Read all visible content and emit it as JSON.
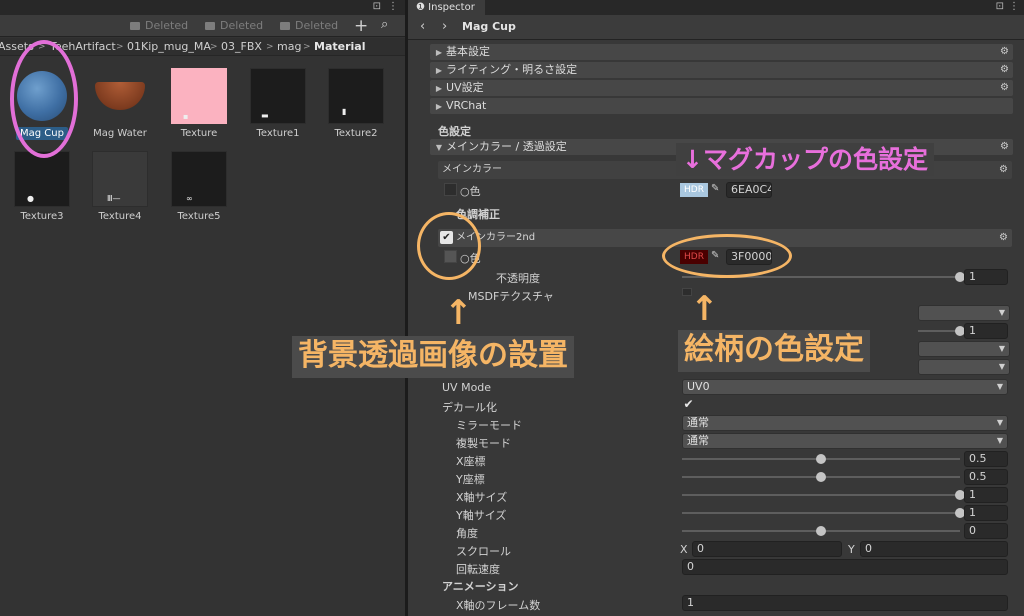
{
  "project": {
    "filters": [
      "Deleted",
      "Deleted",
      "Deleted"
    ],
    "plus_label": "+",
    "breadcrumb": [
      "Assets",
      "TeehArtifact",
      "01Kip_mug_MA",
      "03_FBX",
      "mag",
      "Material"
    ],
    "assets": [
      {
        "label": "Mag Cup",
        "selected": true,
        "thumb": "blue-sphere"
      },
      {
        "label": "Mag Water",
        "thumb": "brown-bowl"
      },
      {
        "label": "Texture",
        "thumb": "pink-square"
      },
      {
        "label": "Texture1",
        "thumb": "dark"
      },
      {
        "label": "Texture2",
        "thumb": "dark"
      },
      {
        "label": "Texture3",
        "thumb": "dark"
      },
      {
        "label": "Texture4",
        "thumb": "dark"
      },
      {
        "label": "Texture5",
        "thumb": "dark"
      }
    ],
    "thumb_marks": {
      "tex4": "Ⅲ—",
      "tex5": "∞"
    }
  },
  "inspector": {
    "tab_label": "Inspector",
    "title": "Mag Cup",
    "foldouts": [
      "基本設定",
      "ライティング・明るさ設定",
      "UV設定",
      "VRChat"
    ],
    "color_section": "色設定",
    "main_color_foldout": "メインカラー / 透過設定",
    "main_color_label": "メインカラー",
    "color_label": "色",
    "hdr_label": "HDR",
    "main_color_hex": "6EA0C4",
    "color_correction": "色調補正",
    "main_color_2nd": "メインカラー2nd",
    "color2_hex": "3F0000",
    "opacity_label": "不透明度",
    "opacity_value": "1",
    "msdf_label": "MSDFテクスチャ",
    "hidden_value": "1",
    "uv_mode_label": "UV Mode",
    "uv_mode_value": "UV0",
    "decal_label": "デカール化",
    "mirror_label": "ミラーモード",
    "mirror_value": "通常",
    "copy_label": "複製モード",
    "copy_value": "通常",
    "x_pos_label": "X座標",
    "x_pos_value": "0.5",
    "y_pos_label": "Y座標",
    "y_pos_value": "0.5",
    "x_size_label": "X軸サイズ",
    "x_size_value": "1",
    "y_size_label": "Y軸サイズ",
    "y_size_value": "1",
    "angle_label": "角度",
    "angle_value": "0",
    "scroll_label": "スクロール",
    "scroll_x_label": "X",
    "scroll_x_value": "0",
    "scroll_y_label": "Y",
    "scroll_y_value": "0",
    "rotation_label": "回転速度",
    "rotation_value": "0",
    "animation_label": "アニメーション",
    "frames_label": "X軸のフレーム数",
    "frames_value": "1"
  },
  "annotations": {
    "cup_color": "↓マグカップの色設定",
    "arrow": "↑",
    "bg_transparent": "背景透過画像の設置",
    "pattern_color": "絵柄の色設定"
  },
  "colors": {
    "main_color": "#6EA0C4",
    "color2": "#3F0000",
    "annotation_orange": "#F5B565",
    "annotation_pink": "#E86FDC"
  }
}
